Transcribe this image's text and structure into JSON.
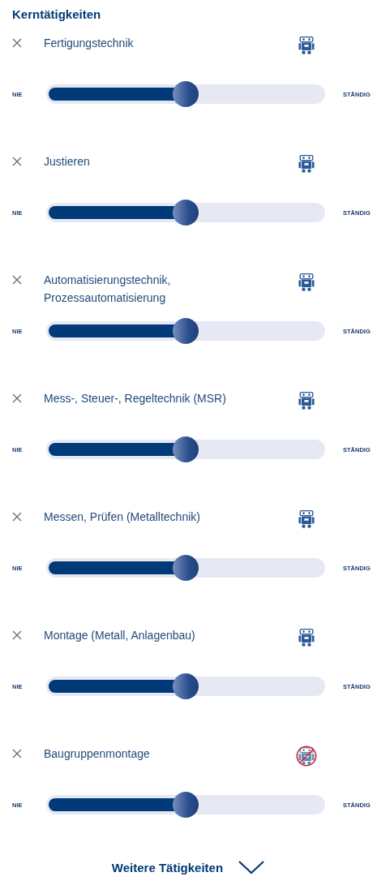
{
  "section_title": "Kerntätigkeiten",
  "activities": [
    {
      "label": "Fertigungstechnik",
      "level": 0.5,
      "automation_excluded": false,
      "min_label": "NIE",
      "max_label": "STÄNDIG"
    },
    {
      "label": "Justieren",
      "level": 0.5,
      "automation_excluded": false,
      "min_label": "NIE",
      "max_label": "STÄNDIG"
    },
    {
      "label": "Automatisierungstechnik, Prozessautomatisierung",
      "level": 0.5,
      "automation_excluded": false,
      "min_label": "NIE",
      "max_label": "STÄNDIG"
    },
    {
      "label": "Mess-, Steuer-, Regeltechnik (MSR)",
      "level": 0.5,
      "automation_excluded": false,
      "min_label": "NIE",
      "max_label": "STÄNDIG"
    },
    {
      "label": "Messen, Prüfen (Metalltechnik)",
      "level": 0.5,
      "automation_excluded": false,
      "min_label": "NIE",
      "max_label": "STÄNDIG"
    },
    {
      "label": "Montage (Metall, Anlagenbau)",
      "level": 0.5,
      "automation_excluded": false,
      "min_label": "NIE",
      "max_label": "STÄNDIG"
    },
    {
      "label": "Baugruppenmontage",
      "level": 0.5,
      "automation_excluded": true,
      "min_label": "NIE",
      "max_label": "STÄNDIG"
    }
  ],
  "more_button": "Weitere Tätigkeiten"
}
